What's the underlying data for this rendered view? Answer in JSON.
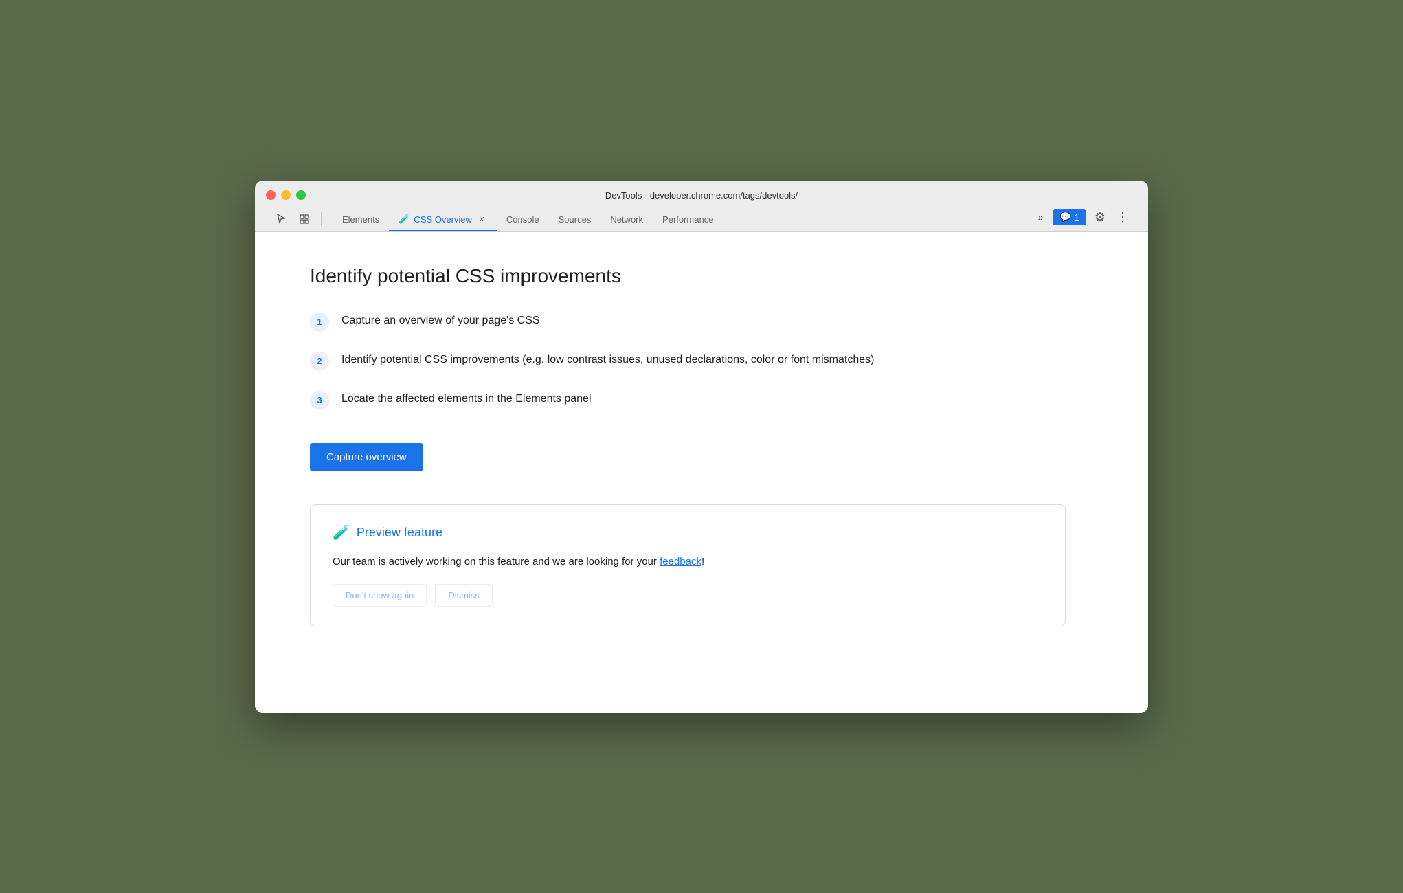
{
  "window": {
    "title": "DevTools - developer.chrome.com/tags/devtools/"
  },
  "tabs": [
    {
      "id": "elements",
      "label": "Elements",
      "active": false,
      "closeable": false
    },
    {
      "id": "css-overview",
      "label": "CSS Overview",
      "active": true,
      "closeable": true,
      "has_flask": true
    },
    {
      "id": "console",
      "label": "Console",
      "active": false,
      "closeable": false
    },
    {
      "id": "sources",
      "label": "Sources",
      "active": false,
      "closeable": false
    },
    {
      "id": "network",
      "label": "Network",
      "active": false,
      "closeable": false
    },
    {
      "id": "performance",
      "label": "Performance",
      "active": false,
      "closeable": false
    }
  ],
  "more_tabs_label": "»",
  "feedback_badge": "1",
  "main": {
    "title": "Identify potential CSS improvements",
    "steps": [
      {
        "number": "1",
        "text": "Capture an overview of your page's CSS"
      },
      {
        "number": "2",
        "text": "Identify potential CSS improvements (e.g. low contrast issues, unused declarations, color or font mismatches)"
      },
      {
        "number": "3",
        "text": "Locate the affected elements in the Elements panel"
      }
    ],
    "capture_button_label": "Capture overview",
    "preview_section": {
      "icon": "🧪",
      "title": "Preview feature",
      "body_text": "Our team is actively working on this feature and we are looking for your ",
      "feedback_link_text": "feedback",
      "body_text_suffix": "!"
    }
  }
}
